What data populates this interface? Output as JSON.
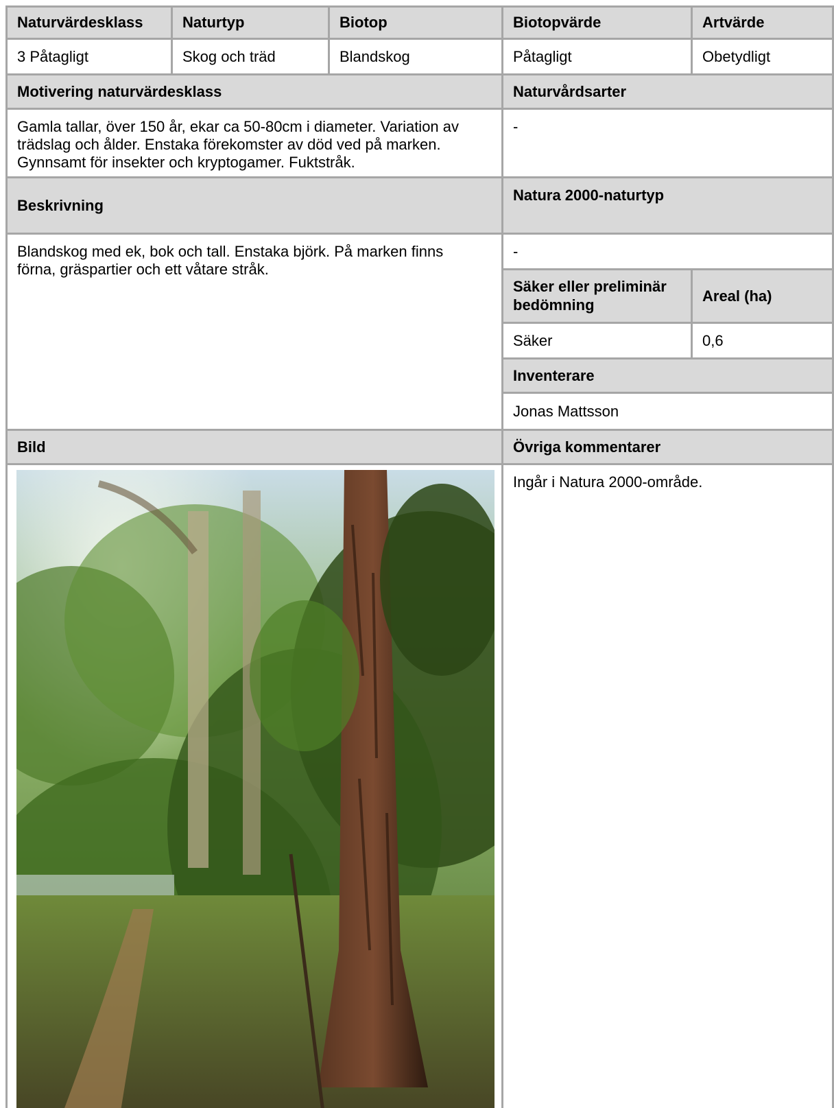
{
  "summary": {
    "headers": [
      "Naturvärdesklass",
      "Naturtyp",
      "Biotop",
      "Biotopvärde",
      "Artvärde"
    ],
    "values": [
      "3 Påtagligt",
      "Skog och träd",
      "Blandskog",
      "Påtagligt",
      "Obetydligt"
    ]
  },
  "motivering": {
    "label": "Motivering naturvärdesklass",
    "text": "Gamla tallar, över 150 år, ekar ca 50-80cm i diameter. Variation av trädslag och ålder. Enstaka förekomster av död ved på marken. Gynnsamt för insekter och kryptogamer. Fuktstråk."
  },
  "naturvardsarter": {
    "label": "Naturvårdsarter",
    "value": "-"
  },
  "beskrivning": {
    "label": "Beskrivning",
    "text": "Blandskog med ek, bok och tall. Enstaka björk. På marken finns förna, gräspartier och ett våtare stråk."
  },
  "natura2000": {
    "label": "Natura 2000-naturtyp",
    "value": "-"
  },
  "bedomning": {
    "label": "Säker eller preliminär bedömning",
    "value": "Säker"
  },
  "areal": {
    "label": "Areal (ha)",
    "value": "0,6"
  },
  "inventerare": {
    "label": "Inventerare",
    "value": "Jonas Mattsson"
  },
  "bild": {
    "label": "Bild",
    "photo_icon": "forest-photo"
  },
  "ovriga": {
    "label": "Övriga kommentarer",
    "text": "Ingår i Natura 2000-område."
  },
  "colors": {
    "header_bg": "#d9d9d9",
    "border": "#a6a6a6"
  }
}
